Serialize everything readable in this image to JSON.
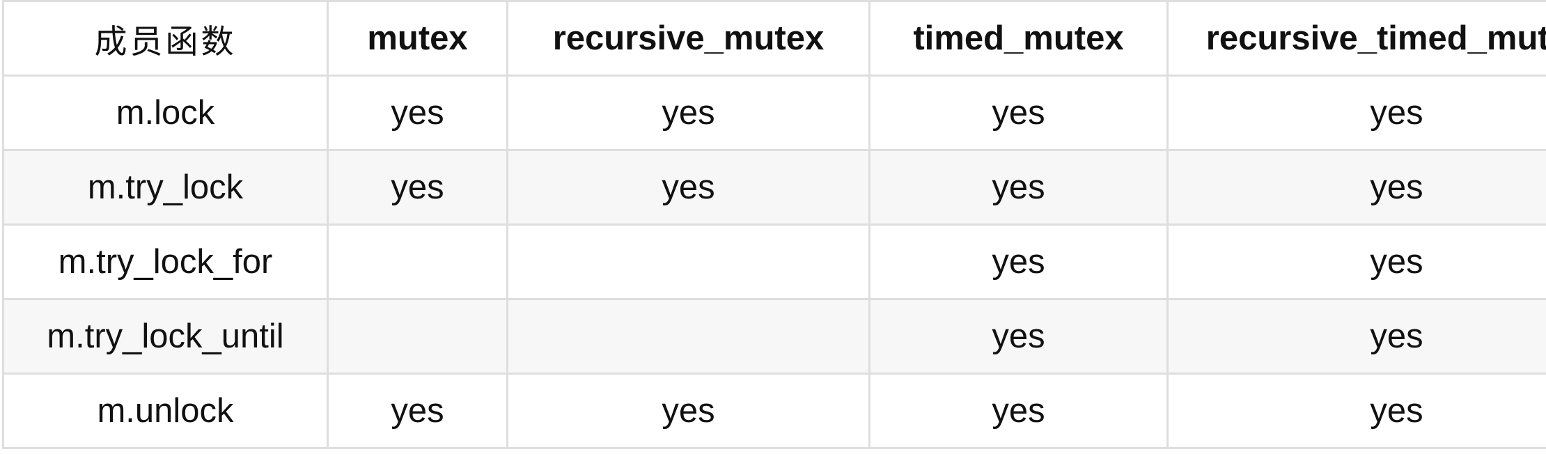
{
  "table": {
    "headers": [
      "成员函数",
      "mutex",
      "recursive_mutex",
      "timed_mutex",
      "recursive_timed_mutex"
    ],
    "rows": [
      [
        "m.lock",
        "yes",
        "yes",
        "yes",
        "yes"
      ],
      [
        "m.try_lock",
        "yes",
        "yes",
        "yes",
        "yes"
      ],
      [
        "m.try_lock_for",
        "",
        "",
        "yes",
        "yes"
      ],
      [
        "m.try_lock_until",
        "",
        "",
        "yes",
        "yes"
      ],
      [
        "m.unlock",
        "yes",
        "yes",
        "yes",
        "yes"
      ]
    ]
  },
  "colors": {
    "border": "#dedede",
    "row_alt": "#f7f7f7",
    "text": "#111111"
  }
}
